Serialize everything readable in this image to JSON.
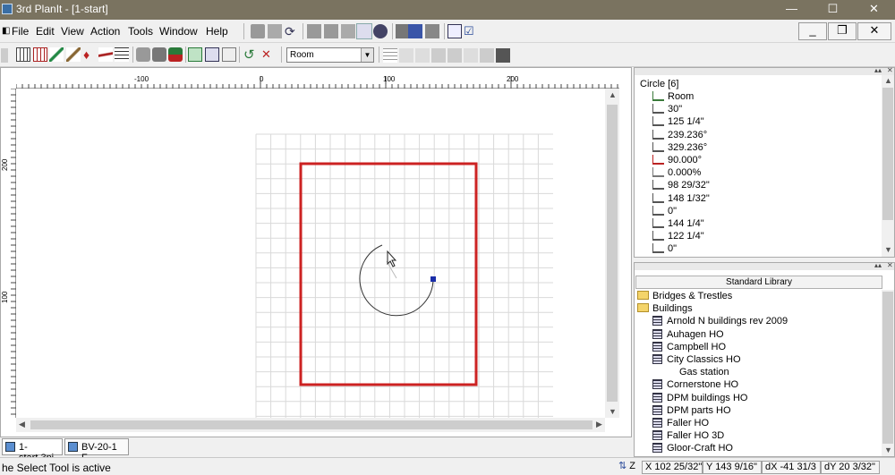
{
  "window": {
    "title": "3rd PlanIt - [1-start]",
    "minimize_glyph": "—",
    "maximize_glyph": "☐",
    "close_glyph": "✕"
  },
  "menubar": {
    "items": [
      "File",
      "Edit",
      "View",
      "Action",
      "Tools",
      "Window",
      "Help"
    ],
    "mdi_minimize": "_",
    "mdi_restore": "❐",
    "mdi_close": "✕"
  },
  "toolbar": {
    "layer_select_value": "Room"
  },
  "rulers": {
    "top_labels": [
      "-100",
      "0",
      "100",
      "200"
    ],
    "left_labels": [
      "200",
      "100"
    ]
  },
  "tabs": [
    "1-start.3pi",
    "BV-20-1 F..."
  ],
  "status": {
    "message": "he Select Tool is active",
    "z_label": "Z",
    "x": "X 102 25/32\"",
    "y": "Y 143 9/16\"",
    "dx": "dX -41 31/3",
    "dy": "dY 20 3/32\""
  },
  "properties": {
    "title": "Circle [6]",
    "rows": [
      "Room",
      "30\"",
      "125 1/4\"",
      "239.236°",
      "329.236°",
      "90.000°",
      "0.000%",
      "98 29/32\"",
      "148 1/32\"",
      "0\"",
      "144 1/4\"",
      "122 1/4\"",
      "0\""
    ]
  },
  "library": {
    "title": "Standard Library",
    "items": [
      {
        "label": "Bridges & Trestles",
        "kind": "folder"
      },
      {
        "label": "Buildings",
        "kind": "folder"
      },
      {
        "label": "Arnold N buildings rev 2009",
        "kind": "book"
      },
      {
        "label": "Auhagen HO",
        "kind": "book"
      },
      {
        "label": "Campbell HO",
        "kind": "book"
      },
      {
        "label": "City Classics HO",
        "kind": "book"
      },
      {
        "label": "Gas station",
        "kind": "sub"
      },
      {
        "label": "Cornerstone HO",
        "kind": "book"
      },
      {
        "label": "DPM buildings HO",
        "kind": "book"
      },
      {
        "label": "DPM parts HO",
        "kind": "book"
      },
      {
        "label": "Faller HO",
        "kind": "book"
      },
      {
        "label": "Faller HO 3D",
        "kind": "book"
      },
      {
        "label": "Gloor-Craft HO",
        "kind": "book"
      }
    ]
  },
  "colors": {
    "room_outline": "#cc2222",
    "grid": "#d9d9d9",
    "selection_handle": "#1a2ea8"
  }
}
